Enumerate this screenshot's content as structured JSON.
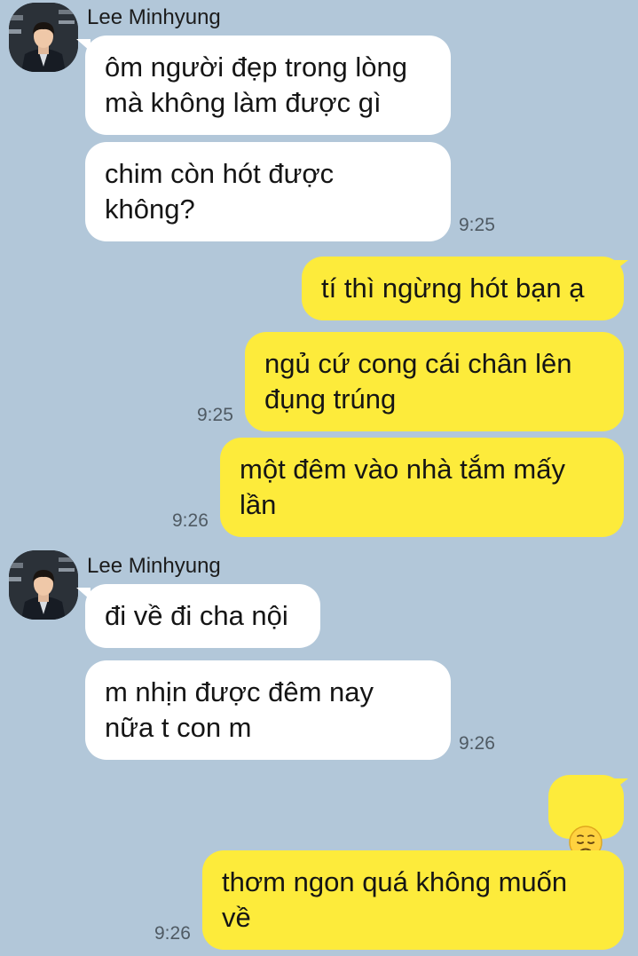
{
  "contact": {
    "name": "Lee Minhyung"
  },
  "messages": [
    {
      "text": "ôm người đẹp trong lòng\nmà không làm được gì"
    },
    {
      "text": "chim còn hót được\nkhông?",
      "time": "9:25"
    },
    {
      "text": "tí thì ngừng hót bạn ạ"
    },
    {
      "text": "ngủ cứ cong cái chân lên\nđụng trúng",
      "time": "9:25"
    },
    {
      "text": "một đêm vào nhà tắm mấy\nlần",
      "time": "9:26"
    },
    {
      "text": "đi về đi cha nội"
    },
    {
      "text": "m nhịn được đêm nay\nnữa t con m",
      "time": "9:26"
    },
    {
      "emoji": "pensive-face"
    },
    {
      "text": "thơm ngon quá không muốn\nvề",
      "time": "9:26"
    }
  ],
  "colors": {
    "background": "#b2c7d9",
    "incoming_bubble": "#ffffff",
    "outgoing_bubble": "#fdeb3b"
  }
}
